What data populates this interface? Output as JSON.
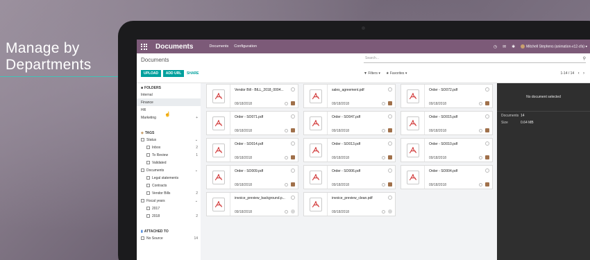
{
  "promo": {
    "line1": "Manage by",
    "line2": "Departments",
    "accent": "#3fc4b8"
  },
  "topbar": {
    "app_title": "Documents",
    "menu": [
      "Documents",
      "Configuration"
    ],
    "user": "Mitchell Stephens (animation-v12-cfa)",
    "brand_color": "#7c5a78"
  },
  "control": {
    "breadcrumb": "Documents",
    "search_placeholder": "Search...",
    "upload": "UPLOAD",
    "add_url": "ADD URL",
    "share": "SHARE",
    "filters": "Filters",
    "favorites": "Favorites",
    "pager": "1-14 / 14"
  },
  "sidebar": {
    "folders_title": "FOLDERS",
    "folders": [
      {
        "label": "Internal"
      },
      {
        "label": "Finance",
        "active": true
      },
      {
        "label": "HR"
      },
      {
        "label": "Marketing",
        "expand": "+"
      }
    ],
    "tags_title": "TAGS",
    "status_label": "Status",
    "status_items": [
      {
        "label": "Inbox",
        "count": "2"
      },
      {
        "label": "To Review",
        "count": "1"
      },
      {
        "label": "Validated",
        "count": ""
      }
    ],
    "documents_label": "Documents",
    "documents_items": [
      {
        "label": "Legal statements",
        "count": ""
      },
      {
        "label": "Contracts",
        "count": ""
      },
      {
        "label": "Vendor Bills",
        "count": "2"
      }
    ],
    "fiscal_label": "Fiscal years",
    "fiscal_items": [
      {
        "label": "2017",
        "count": ""
      },
      {
        "label": "2018",
        "count": "2"
      }
    ],
    "attached_title": "ATTACHED TO",
    "attached_items": [
      {
        "label": "No Source",
        "count": "14"
      }
    ]
  },
  "documents": [
    {
      "name": "Vendor Bill - BILL_2018_0004...",
      "date": "09/18/2018",
      "avatar": "brown"
    },
    {
      "name": "sales_agreement.pdf",
      "date": "09/18/2018",
      "avatar": "brown"
    },
    {
      "name": "Order - SO072.pdf",
      "date": "09/18/2018",
      "avatar": "brown"
    },
    {
      "name": "Order - SO071.pdf",
      "date": "09/18/2018",
      "avatar": "brown"
    },
    {
      "name": "Order - SO047.pdf",
      "date": "09/18/2018",
      "avatar": "brown"
    },
    {
      "name": "Order - SO015.pdf",
      "date": "09/18/2018",
      "avatar": "brown"
    },
    {
      "name": "Order - SO014.pdf",
      "date": "09/18/2018",
      "avatar": "brown"
    },
    {
      "name": "Order - SO013.pdf",
      "date": "09/18/2018",
      "avatar": "brown"
    },
    {
      "name": "Order - SO010.pdf",
      "date": "09/18/2018",
      "avatar": "brown"
    },
    {
      "name": "Order - SO009.pdf",
      "date": "09/18/2018",
      "avatar": "brown"
    },
    {
      "name": "Order - SO006.pdf",
      "date": "09/18/2018",
      "avatar": "brown"
    },
    {
      "name": "Order - SO004.pdf",
      "date": "09/18/2018",
      "avatar": "brown"
    },
    {
      "name": "invoice_preview_background.p...",
      "date": "09/18/2018",
      "avatar": "gray"
    },
    {
      "name": "invoice_preview_clean.pdf",
      "date": "09/18/2018",
      "avatar": "gray"
    }
  ],
  "rpanel": {
    "empty": "No document selected",
    "documents_label": "Documents",
    "documents_value": "14",
    "size_label": "Size",
    "size_value": "0.64 MB"
  }
}
